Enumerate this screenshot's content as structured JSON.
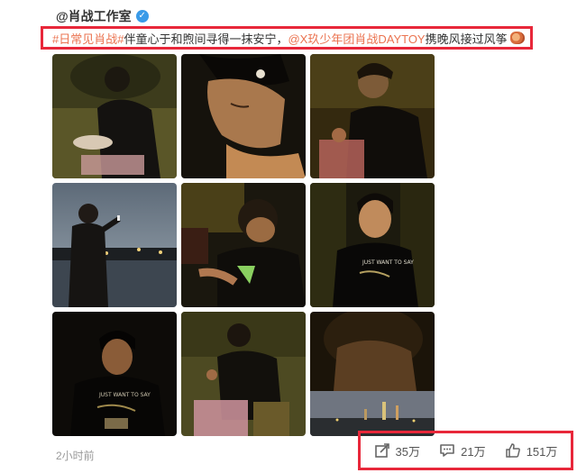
{
  "post": {
    "username": "@肖战工作室",
    "verified_icon": "verified-badge-icon",
    "text": {
      "tag": "#日常见肖战#",
      "body1": " 伴童心于和煦间寻得一抹安宁，",
      "mention": "@X玖少年团肖战DAYTOY",
      "body2": " 携晚风接过风筝"
    },
    "timestamp": "2小时前",
    "photos": [
      "photo-1",
      "photo-2",
      "photo-3",
      "photo-4",
      "photo-5",
      "photo-6",
      "photo-7",
      "photo-8",
      "photo-9"
    ],
    "actions": {
      "share": {
        "icon": "share-icon",
        "count": "35万"
      },
      "comment": {
        "icon": "comment-icon",
        "count": "21万"
      },
      "like": {
        "icon": "thumbs-up-icon",
        "count": "151万"
      }
    }
  },
  "colors": {
    "highlight_border": "#e8273a",
    "link": "#eb7350",
    "verified": "#3a9be8"
  }
}
